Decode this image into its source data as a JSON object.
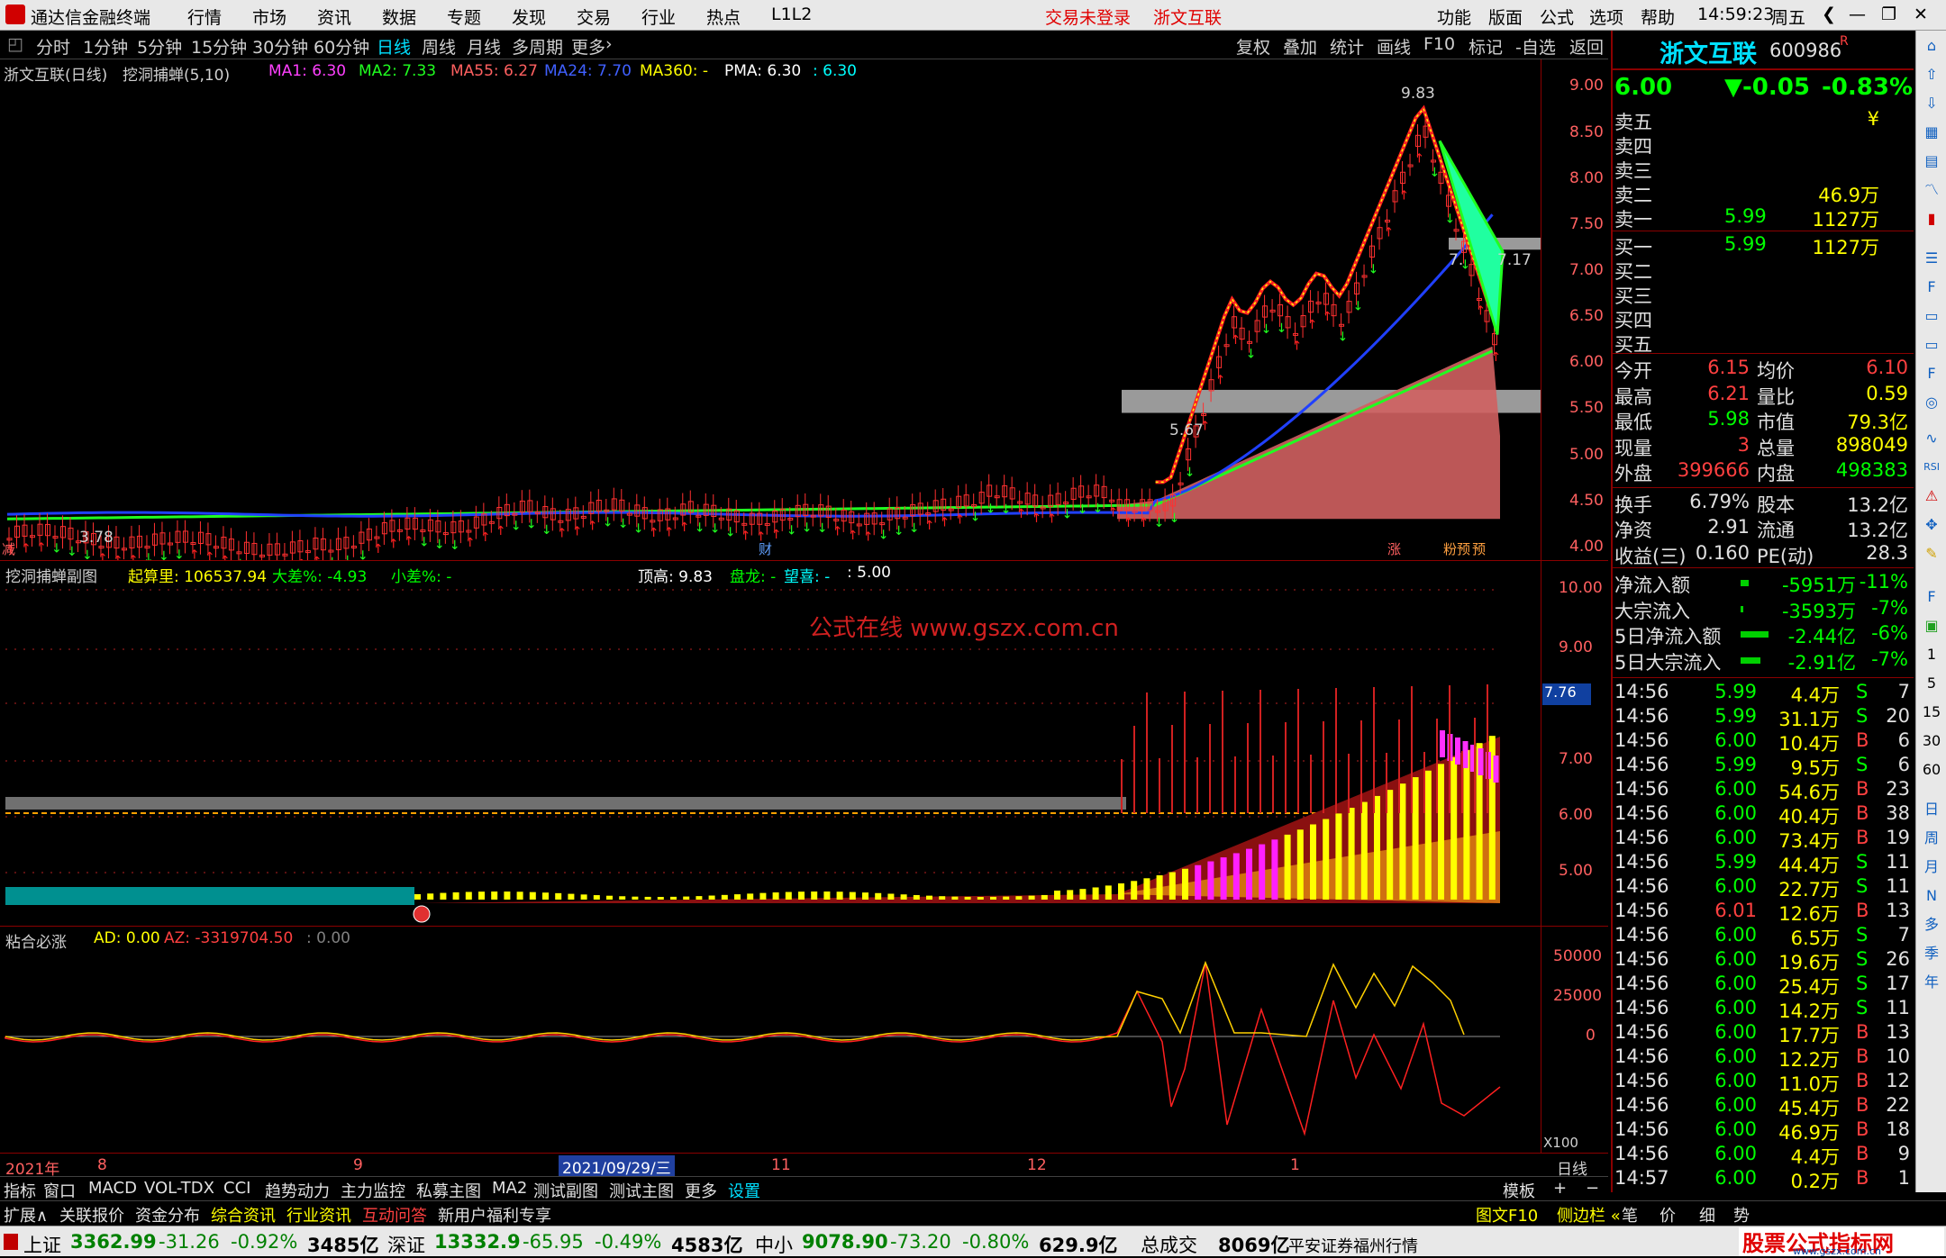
{
  "titlebar": {
    "app_name": "通达信金融终端",
    "menu": [
      "行情",
      "市场",
      "资讯",
      "数据",
      "专题",
      "发现",
      "交易",
      "行业",
      "热点",
      "L1L2"
    ],
    "notice": "交易未登录",
    "stock_link": "浙文互联",
    "right_menu": [
      "功能",
      "版面",
      "公式",
      "选项",
      "帮助"
    ],
    "time": "14:59:23",
    "weekday": "周五"
  },
  "periods": [
    "分时",
    "1分钟",
    "5分钟",
    "15分钟",
    "30分钟",
    "60分钟",
    "日线",
    "周线",
    "月线",
    "多周期",
    "更多"
  ],
  "active_period": "日线",
  "chart_tools": [
    "复权",
    "叠加",
    "统计",
    "画线",
    "F10",
    "标记",
    "-自选",
    "返回"
  ],
  "main_chart": {
    "title": "浙文互联(日线)",
    "indicator": "挖洞捕蝉(5,10)",
    "legend": [
      {
        "text": "MA1: 6.30",
        "color": "#ff40ff"
      },
      {
        "text": "MA2: 7.33",
        "color": "#20ff20"
      },
      {
        "text": "MA55: 6.27",
        "color": "#ff6060"
      },
      {
        "text": "MA24: 7.70",
        "color": "#4060ff"
      },
      {
        "text": "MA360: -",
        "color": "#ffff00"
      },
      {
        "text": "PMA: 6.30",
        "color": "#ffffff"
      },
      {
        "text": ": 6.30",
        "color": "#00ffff"
      }
    ],
    "y_ticks": [
      "9.00",
      "8.50",
      "8.00",
      "7.50",
      "7.00",
      "6.50",
      "6.00",
      "5.50",
      "5.00",
      "4.50",
      "4.00"
    ],
    "high_label": "9.83",
    "low_label": "3.78",
    "mid_label": "5.67",
    "r_label1": "7.",
    "r_label2": "7.17",
    "bottom_marks": [
      "减",
      "财",
      "涨",
      "粉预",
      "预"
    ]
  },
  "sub_chart": {
    "title": "挖洞捕蝉副图",
    "items": [
      {
        "text": "起算里: 106537.94",
        "color": "#ffff00"
      },
      {
        "text": "大差%: -4.93",
        "color": "#00ff00"
      },
      {
        "text": "小差%: -",
        "color": "#00ff00"
      },
      {
        "text": "顶高: 9.83",
        "color": "#ffffff"
      },
      {
        "text": "盘龙: -",
        "color": "#00ff00"
      },
      {
        "text": "望喜: -",
        "color": "#00ffff"
      },
      {
        "text": ": 5.00",
        "color": "#ffffff"
      }
    ],
    "watermark": "公式在线  www.gszx.com.cn",
    "y_ticks": [
      "10.00",
      "9.00",
      "7.00",
      "6.00",
      "5.00"
    ],
    "current": "7.76"
  },
  "macd_chart": {
    "title": "粘合必涨",
    "items": [
      {
        "text": "AD: 0.00",
        "color": "#ffff00"
      },
      {
        "text": "AZ: -3319704.50",
        "color": "#ff4040"
      },
      {
        "text": ": 0.00",
        "color": "#808080"
      }
    ],
    "y_ticks": [
      "50000",
      "25000",
      "0"
    ],
    "scale": "X100"
  },
  "x_axis": {
    "labels": [
      "2021年",
      "8",
      "9",
      "2021/09/29/三",
      "11",
      "12",
      "1"
    ],
    "period": "日线"
  },
  "tabs": [
    "指标",
    "窗口",
    "MACD",
    "VOL-TDX",
    "CCI",
    "趋势动力",
    "主力监控",
    "私募主图",
    "MA2",
    "测试副图",
    "测试主图",
    "更多",
    "设置"
  ],
  "tabs_right": [
    "模板",
    "+",
    "−"
  ],
  "tabs2": [
    {
      "text": "扩展∧",
      "color": "#e0e0e0"
    },
    {
      "text": "关联报价",
      "color": "#e0e0e0"
    },
    {
      "text": "资金分布",
      "color": "#e0e0e0"
    },
    {
      "text": "综合资讯",
      "color": "#ffff00"
    },
    {
      "text": "行业资讯",
      "color": "#ffff00"
    },
    {
      "text": "互动问答",
      "color": "#ff4040"
    },
    {
      "text": "新用户福利专享",
      "color": "#e0e0e0"
    }
  ],
  "tabs2_right": [
    "图文F10",
    "侧边栏 «",
    "笔",
    "价",
    "细",
    "势"
  ],
  "quote": {
    "name": "浙文互联",
    "code": "600986",
    "mark": "R",
    "price": "6.00",
    "change": "▼-0.05",
    "pct": "-0.83%",
    "asks": [
      {
        "label": "卖五",
        "price": "",
        "vol": "¥"
      },
      {
        "label": "卖四",
        "price": "",
        "vol": ""
      },
      {
        "label": "卖三",
        "price": "",
        "vol": ""
      },
      {
        "label": "卖二",
        "price": "",
        "vol": "46.9万"
      },
      {
        "label": "卖一",
        "price": "5.99",
        "vol": "1127万"
      }
    ],
    "bids": [
      {
        "label": "买一",
        "price": "5.99",
        "vol": "1127万"
      },
      {
        "label": "买二",
        "price": "",
        "vol": ""
      },
      {
        "label": "买三",
        "price": "",
        "vol": ""
      },
      {
        "label": "买四",
        "price": "",
        "vol": ""
      },
      {
        "label": "买五",
        "price": "",
        "vol": ""
      }
    ],
    "stats": [
      {
        "l1": "今开",
        "v1": "6.15",
        "c1": "#ff4040",
        "l2": "均价",
        "v2": "6.10",
        "c2": "#ff4040"
      },
      {
        "l1": "最高",
        "v1": "6.21",
        "c1": "#ff4040",
        "l2": "量比",
        "v2": "0.59",
        "c2": "#ffff00"
      },
      {
        "l1": "最低",
        "v1": "5.98",
        "c1": "#00ff00",
        "l2": "市值",
        "v2": "79.3亿",
        "c2": "#ffff00"
      },
      {
        "l1": "现量",
        "v1": "3",
        "c1": "#ff4040",
        "l2": "总量",
        "v2": "898049",
        "c2": "#ffff00"
      },
      {
        "l1": "外盘",
        "v1": "399666",
        "c1": "#ff4040",
        "l2": "内盘",
        "v2": "498383",
        "c2": "#00ff00"
      }
    ],
    "stats2": [
      {
        "l1": "换手",
        "v1": "6.79%",
        "l2": "股本",
        "v2": "13.2亿"
      },
      {
        "l1": "净资",
        "v1": "2.91",
        "l2": "流通",
        "v2": "13.2亿"
      },
      {
        "l1": "收益(三)",
        "v1": "0.160",
        "l2": "PE(动)",
        "v2": "28.3"
      }
    ],
    "flows": [
      {
        "label": "净流入额",
        "val": "-5951万",
        "pct": "-11%",
        "bar": 8
      },
      {
        "label": "大宗流入",
        "val": "-3593万",
        "pct": "-7%",
        "bar": 3
      },
      {
        "label": "5日净流入额",
        "val": "-2.44亿",
        "pct": "-6%",
        "bar": 28
      },
      {
        "label": "5日大宗流入",
        "val": "-2.91亿",
        "pct": "-7%",
        "bar": 20
      }
    ],
    "ticks": [
      [
        "14:56",
        "5.99",
        "4.4万",
        "S",
        "7"
      ],
      [
        "14:56",
        "5.99",
        "31.1万",
        "S",
        "20"
      ],
      [
        "14:56",
        "6.00",
        "10.4万",
        "B",
        "6"
      ],
      [
        "14:56",
        "5.99",
        "9.5万",
        "S",
        "6"
      ],
      [
        "14:56",
        "6.00",
        "54.6万",
        "B",
        "23"
      ],
      [
        "14:56",
        "6.00",
        "40.4万",
        "B",
        "38"
      ],
      [
        "14:56",
        "6.00",
        "73.4万",
        "B",
        "19"
      ],
      [
        "14:56",
        "5.99",
        "44.4万",
        "S",
        "11"
      ],
      [
        "14:56",
        "6.00",
        "22.7万",
        "S",
        "11"
      ],
      [
        "14:56",
        "6.01",
        "12.6万",
        "B",
        "13"
      ],
      [
        "14:56",
        "6.00",
        "6.5万",
        "S",
        "7"
      ],
      [
        "14:56",
        "6.00",
        "19.6万",
        "S",
        "26"
      ],
      [
        "14:56",
        "6.00",
        "25.4万",
        "S",
        "17"
      ],
      [
        "14:56",
        "6.00",
        "14.2万",
        "S",
        "11"
      ],
      [
        "14:56",
        "6.00",
        "17.7万",
        "B",
        "13"
      ],
      [
        "14:56",
        "6.00",
        "12.2万",
        "B",
        "10"
      ],
      [
        "14:56",
        "6.00",
        "11.0万",
        "B",
        "12"
      ],
      [
        "14:56",
        "6.00",
        "45.4万",
        "B",
        "22"
      ],
      [
        "14:56",
        "6.00",
        "46.9万",
        "B",
        "18"
      ],
      [
        "14:56",
        "6.00",
        "4.4万",
        "B",
        "9"
      ],
      [
        "14:57",
        "6.00",
        "0.2万",
        "B",
        "1"
      ]
    ]
  },
  "sidebar_labels": [
    "日",
    "周",
    "月",
    "N",
    "多",
    "季",
    "年"
  ],
  "status_bar": {
    "indices": [
      {
        "name": "上证",
        "val": "3362.99",
        "chg": "-31.26",
        "pct": "-0.92%",
        "amt": "3485亿"
      },
      {
        "name": "深证",
        "val": "13332.9",
        "chg": "-65.95",
        "pct": "-0.49%",
        "amt": "4583亿"
      },
      {
        "name": "中小",
        "val": "9078.90",
        "chg": "-73.20",
        "pct": "-0.80%",
        "amt": "629.9亿"
      }
    ],
    "total_label": "总成交",
    "total": "8069亿",
    "broker": "平安证券福州行情",
    "logo_text": "股票公式指标网",
    "logo_url": "www.gszx.com.cn"
  }
}
